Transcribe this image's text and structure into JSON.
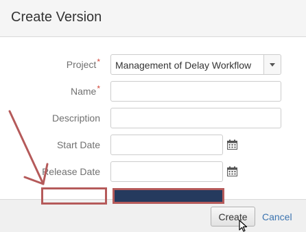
{
  "dialog": {
    "title": "Create Version"
  },
  "form": {
    "project": {
      "label": "Project",
      "required_mark": "*",
      "selected": "Management of Delay Workflow"
    },
    "name": {
      "label": "Name",
      "required_mark": "*",
      "value": ""
    },
    "description": {
      "label": "Description",
      "value": ""
    },
    "start_date": {
      "label": "Start Date",
      "value": "",
      "icon": "calendar-icon"
    },
    "release_date": {
      "label": "Release Date",
      "value": "",
      "icon": "calendar-icon"
    }
  },
  "footer": {
    "create_label": "Create",
    "cancel_label": "Cancel"
  },
  "colors": {
    "accent_link": "#3b73af",
    "required": "#d04437",
    "annotation": "#b55a5a",
    "redaction_fill": "#253a5e"
  }
}
